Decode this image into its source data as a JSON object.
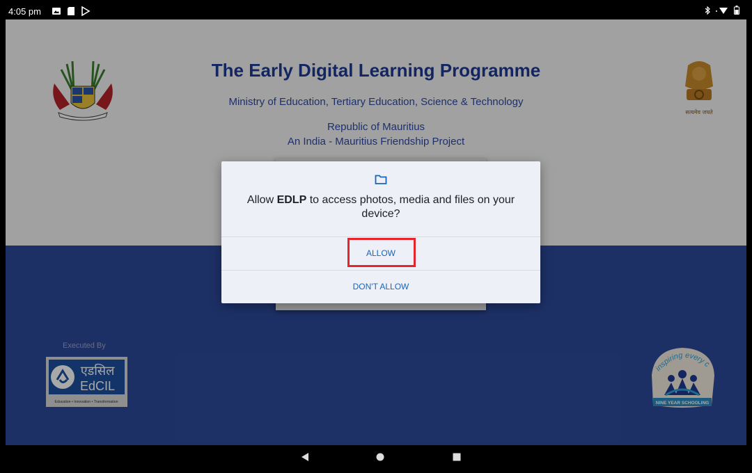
{
  "status_bar": {
    "time": "4:05 pm"
  },
  "app": {
    "title": "The Early Digital Learning Programme",
    "ministry": "Ministry of Education, Tertiary Education, Science & Technology",
    "republic": "Republic of Mauritius",
    "project": "An India - Mauritius Friendship Project",
    "executed_by": "Executed By",
    "edcil": {
      "hindi": "एडसिल",
      "name": "EdCIL",
      "tagline": "Education • Innovation • Transformation"
    },
    "nine_year": {
      "arc_text": "inspiring every child",
      "label": "NINE YEAR SCHOOLING"
    },
    "emblem_motto": "सत्यमेव जयते"
  },
  "dialog": {
    "icon": "folder-icon",
    "message_prefix": "Allow ",
    "app_name": "EDLP",
    "message_suffix": " to access photos, media and files on your device?",
    "allow_label": "ALLOW",
    "deny_label": "DON'T ALLOW"
  },
  "colors": {
    "title": "#1f3a93",
    "lower_bg": "#2d4a9b",
    "accent": "#1a64b6",
    "highlight": "#e5242b"
  }
}
